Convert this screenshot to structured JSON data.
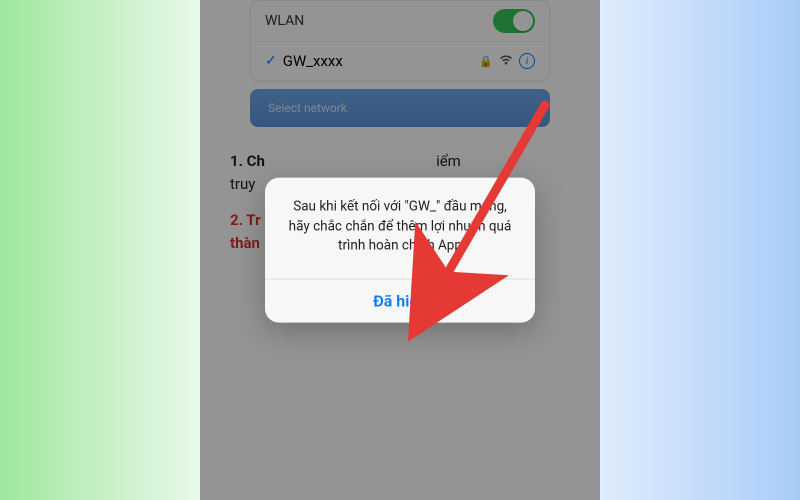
{
  "wlan": {
    "label": "WLAN",
    "network_name": "GW_xxxx",
    "select_network_placeholder": "Select network"
  },
  "instructions": {
    "step1_prefix": "1. Ch",
    "step1_suffix": "iểm",
    "step1_line2": "truy",
    "step2_prefix": "2. Tr",
    "step2_line2": "thàn"
  },
  "alert": {
    "message": "Sau khi kết nối với \"GW_\" đầu mạng, hãy chắc chắn để thêm lợi nhuận quá trình hoàn chỉnh App",
    "ok_label": "Đã hiểu"
  }
}
